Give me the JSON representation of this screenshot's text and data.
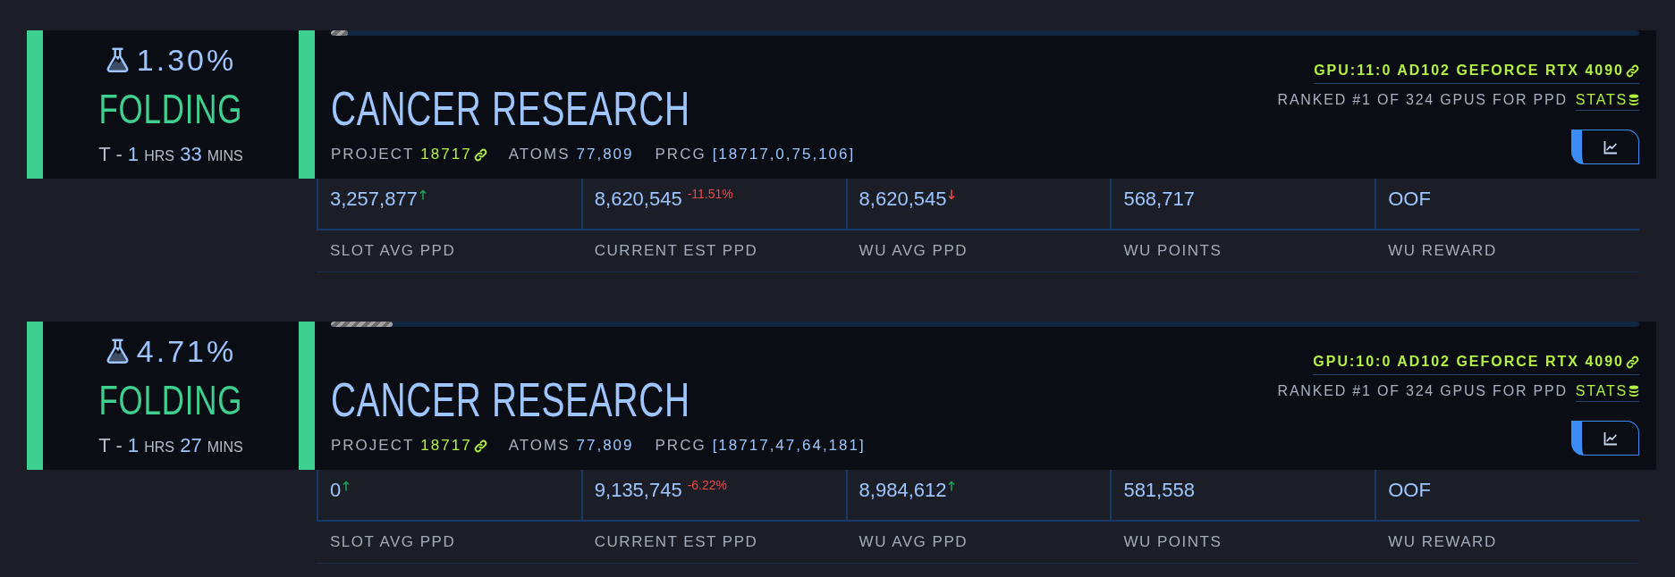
{
  "slots": [
    {
      "progress": {
        "percent": "1.30%",
        "level": 0.013
      },
      "status": "FOLDING",
      "eta": {
        "prefix": "T -",
        "hours": "1",
        "hours_unit": "HRS",
        "minutes": "33",
        "minutes_unit": "MINS"
      },
      "cause": "CANCER RESEARCH",
      "meta": [
        {
          "kind": "link",
          "label": "PROJECT",
          "value": "18717"
        },
        {
          "kind": "plain",
          "label": "ATOMS",
          "value": "77,809"
        },
        {
          "kind": "plain",
          "label": "PRCG",
          "value": "[18717,0,75,106]"
        }
      ],
      "gpu": "GPU:11:0 AD102 GEFORCE RTX 4090",
      "rank": "RANKED #1 OF 324 GPUS FOR PPD",
      "stats_link": "STATS",
      "stats": [
        {
          "label": "SLOT AVG PPD",
          "value": "3,257,877",
          "rising": true,
          "falling": false
        },
        {
          "label": "CURRENT EST PPD",
          "value": "8,620,545",
          "rising": false,
          "falling": false,
          "change": "-11.51%",
          "change_negative": true
        },
        {
          "label": "WU AVG PPD",
          "value": "8,620,545",
          "rising": false,
          "falling": true
        },
        {
          "label": "WU POINTS",
          "value": "568,717",
          "rising": false,
          "falling": false
        },
        {
          "label": "WU REWARD",
          "value": "OOF",
          "rising": false,
          "falling": false
        }
      ]
    },
    {
      "progress": {
        "percent": "4.71%",
        "level": 0.0471
      },
      "status": "FOLDING",
      "eta": {
        "prefix": "T -",
        "hours": "1",
        "hours_unit": "HRS",
        "minutes": "27",
        "minutes_unit": "MINS"
      },
      "cause": "CANCER RESEARCH",
      "meta": [
        {
          "kind": "link",
          "label": "PROJECT",
          "value": "18717"
        },
        {
          "kind": "plain",
          "label": "ATOMS",
          "value": "77,809"
        },
        {
          "kind": "plain",
          "label": "PRCG",
          "value": "[18717,47,64,181]"
        }
      ],
      "gpu": "GPU:10:0 AD102 GEFORCE RTX 4090",
      "rank": "RANKED #1 OF 324 GPUS FOR PPD",
      "stats_link": "STATS",
      "stats": [
        {
          "label": "SLOT AVG PPD",
          "value": "0",
          "rising": true,
          "falling": false
        },
        {
          "label": "CURRENT EST PPD",
          "value": "9,135,745",
          "rising": false,
          "falling": false,
          "change": "-6.22%",
          "change_negative": true
        },
        {
          "label": "WU AVG PPD",
          "value": "8,984,612",
          "rising": true,
          "falling": false
        },
        {
          "label": "WU POINTS",
          "value": "581,558",
          "rising": false,
          "falling": false
        },
        {
          "label": "WU REWARD",
          "value": "OOF",
          "rising": false,
          "falling": false
        }
      ]
    }
  ]
}
